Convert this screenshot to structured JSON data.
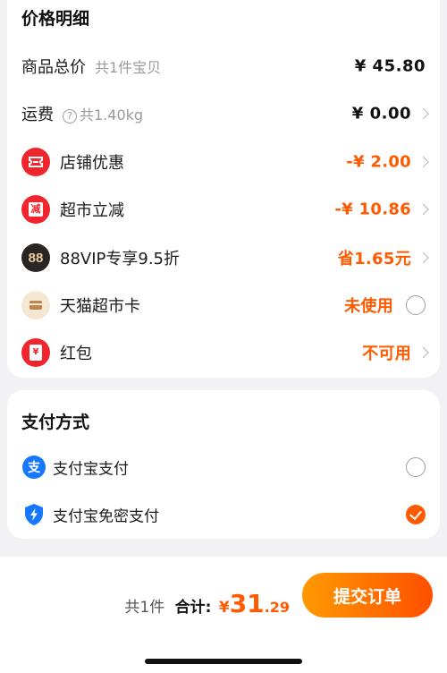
{
  "price_detail": {
    "title": "价格明细",
    "total": {
      "label": "商品总价",
      "sub": "共1件宝贝",
      "value": "¥ 45.80"
    },
    "shipping": {
      "label": "运费",
      "help": "?",
      "sub": "共1.40kg",
      "value": "¥ 0.00"
    },
    "shop_coupon": {
      "label": "店铺优惠",
      "value": "-¥ 2.00"
    },
    "market_cut": {
      "label": "超市立减",
      "icon_text": "减",
      "value": "-¥ 10.86"
    },
    "vip": {
      "label": "88VIP专享9.5折",
      "icon_text": "88",
      "value": "省1.65元"
    },
    "tmall_card": {
      "label": "天猫超市卡",
      "value": "未使用"
    },
    "red_packet": {
      "label": "红包",
      "icon_text": "¥",
      "value": "不可用"
    }
  },
  "payment": {
    "title": "支付方式",
    "alipay": {
      "label": "支付宝支付",
      "icon_text": "支"
    },
    "alipay_nopwd": {
      "label": "支付宝免密支付"
    }
  },
  "footer": {
    "count": "共1件",
    "total_label": "合计:",
    "currency": "¥",
    "amount_int": "31",
    "amount_dec": ".29",
    "submit": "提交订单"
  },
  "colors": {
    "accent": "#ff5a00",
    "red": "#f0262f",
    "alipay": "#1677ff"
  }
}
